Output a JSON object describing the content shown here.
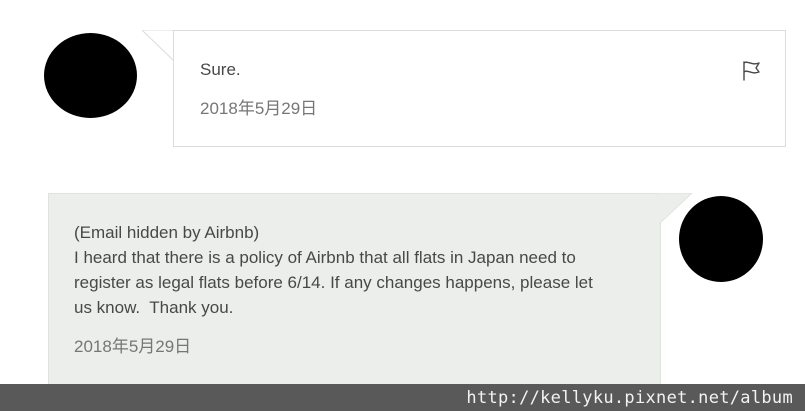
{
  "messages": [
    {
      "sender": "host",
      "text": "Sure.",
      "date": "2018年5月29日",
      "flag_icon": "flag-icon"
    },
    {
      "sender": "guest",
      "lines": [
        "(Email hidden by Airbnb)",
        "I heard that there is a policy of Airbnb that all flats in Japan need to",
        "register as legal flats before 6/14. If any changes happens, please let",
        "us know.  Thank you."
      ],
      "date": "2018年5月29日"
    }
  ],
  "watermark": {
    "text": "http://kellyku.pixnet.net/album"
  },
  "colors": {
    "host_bubble": "#ffffff",
    "guest_bubble": "#eceeeb",
    "text": "#484848",
    "date_text": "#767676",
    "avatar": "#000000",
    "watermark_bar": "#595959"
  }
}
